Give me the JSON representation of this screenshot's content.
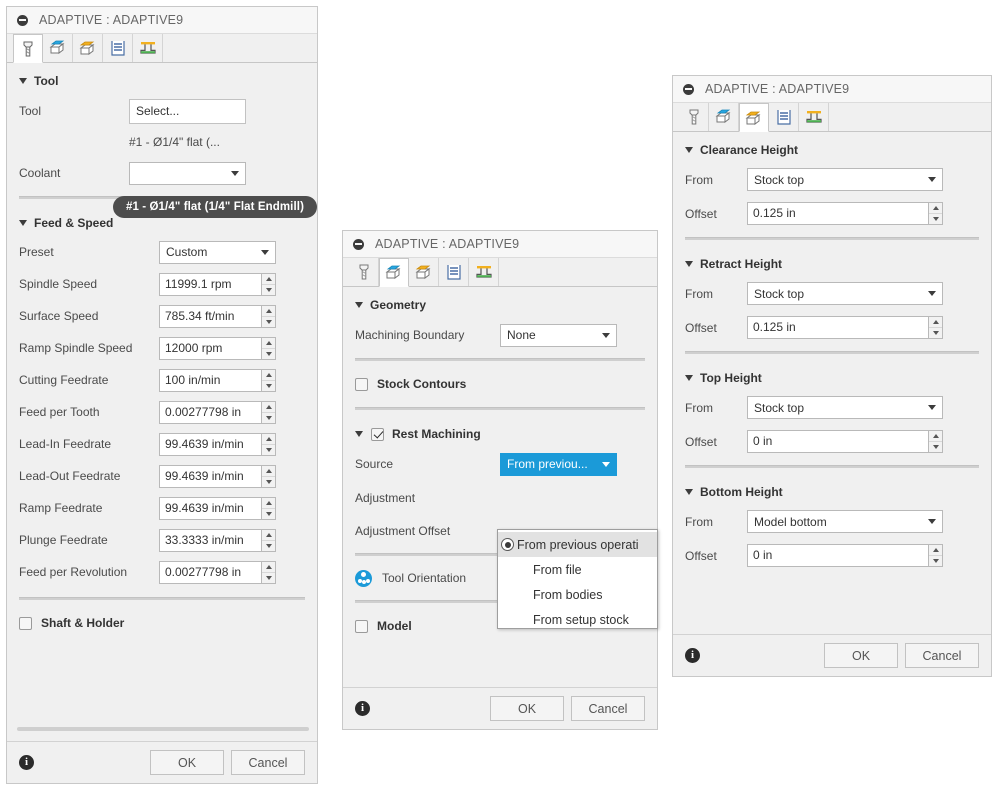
{
  "dialog_tool": {
    "title": "ADAPTIVE : ADAPTIVE9",
    "tabs": [
      {
        "name": "tool-tab",
        "icon": "endmill-icon",
        "active": true
      },
      {
        "name": "geometry-tab",
        "icon": "geometry-box-icon",
        "active": false
      },
      {
        "name": "heights-tab",
        "icon": "heights-box-icon",
        "active": false
      },
      {
        "name": "passes-tab",
        "icon": "passes-icon",
        "active": false
      },
      {
        "name": "linking-tab",
        "icon": "linking-icon",
        "active": false
      }
    ],
    "group_tool": "Tool",
    "tool_label": "Tool",
    "select_button": "Select...",
    "tool_value": "#1 - Ø1/4\" flat (...",
    "coolant_label": "Coolant",
    "tooltip": "#1 - Ø1/4\" flat (1/4\" Flat Endmill)",
    "group_feed": "Feed & Speed",
    "fields": [
      {
        "label": "Preset",
        "value": "Custom",
        "type": "select"
      },
      {
        "label": "Spindle Speed",
        "value": "11999.1 rpm",
        "type": "spinner"
      },
      {
        "label": "Surface Speed",
        "value": "785.34 ft/min",
        "type": "spinner"
      },
      {
        "label": "Ramp Spindle Speed",
        "value": "12000 rpm",
        "type": "spinner"
      },
      {
        "label": "Cutting Feedrate",
        "value": "100 in/min",
        "type": "spinner"
      },
      {
        "label": "Feed per Tooth",
        "value": "0.00277798 in",
        "type": "spinner"
      },
      {
        "label": "Lead-In Feedrate",
        "value": "99.4639 in/min",
        "type": "spinner"
      },
      {
        "label": "Lead-Out Feedrate",
        "value": "99.4639 in/min",
        "type": "spinner"
      },
      {
        "label": "Ramp Feedrate",
        "value": "99.4639 in/min",
        "type": "spinner"
      },
      {
        "label": "Plunge Feedrate",
        "value": "33.3333 in/min",
        "type": "spinner"
      },
      {
        "label": "Feed per Revolution",
        "value": "0.00277798 in",
        "type": "spinner"
      }
    ],
    "shaft_holder": "Shaft & Holder",
    "shaft_holder_checked": false,
    "ok": "OK",
    "cancel": "Cancel"
  },
  "dialog_geometry": {
    "title": "ADAPTIVE : ADAPTIVE9",
    "group_geometry": "Geometry",
    "machining_boundary_label": "Machining Boundary",
    "machining_boundary_value": "None",
    "stock_contours": "Stock Contours",
    "stock_contours_checked": false,
    "rest_machining": "Rest Machining",
    "rest_machining_checked": true,
    "source_label": "Source",
    "source_value": "From previou...",
    "adjustment_label": "Adjustment",
    "adjustment_offset_label": "Adjustment Offset",
    "source_options": [
      "From previous operati",
      "From file",
      "From bodies",
      "From setup stock"
    ],
    "tool_orientation": "Tool Orientation",
    "model": "Model",
    "model_checked": false,
    "ok": "OK",
    "cancel": "Cancel"
  },
  "dialog_heights": {
    "title": "ADAPTIVE : ADAPTIVE9",
    "groups": [
      {
        "title": "Clearance Height",
        "from_label": "From",
        "from_value": "Stock top",
        "offset_label": "Offset",
        "offset_value": "0.125 in"
      },
      {
        "title": "Retract Height",
        "from_label": "From",
        "from_value": "Stock top",
        "offset_label": "Offset",
        "offset_value": "0.125 in"
      },
      {
        "title": "Top Height",
        "from_label": "From",
        "from_value": "Stock top",
        "offset_label": "Offset",
        "offset_value": "0 in"
      },
      {
        "title": "Bottom Height",
        "from_label": "From",
        "from_value": "Model bottom",
        "offset_label": "Offset",
        "offset_value": "0 in"
      }
    ],
    "ok": "OK",
    "cancel": "Cancel"
  },
  "colors": {
    "accent_blue": "#1b9ad8",
    "panel_bg": "#f0f0f0",
    "tooltip_bg": "#4d4d4d",
    "icon_yellow": "#f2b01e",
    "icon_green": "#4caf50",
    "icon_cyan": "#29a7e0"
  }
}
